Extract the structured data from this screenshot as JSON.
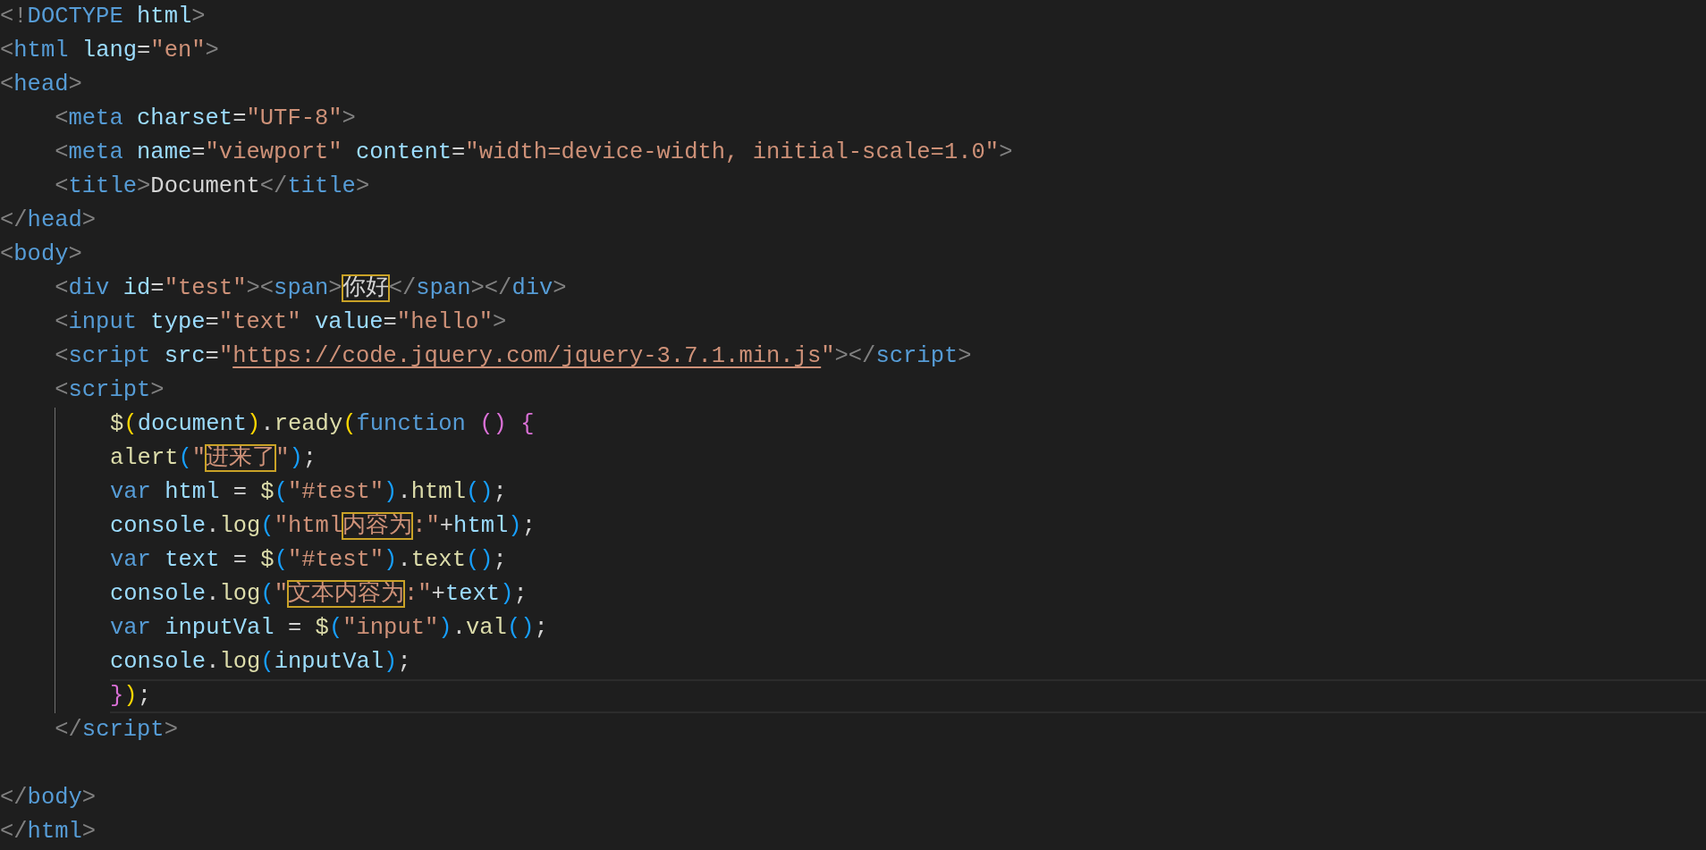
{
  "editor": {
    "lines": [
      {
        "kind": "line",
        "current": false,
        "tokens": [
          {
            "kind": "p",
            "text": "<!"
          },
          {
            "kind": "tag",
            "text": "DOCTYPE"
          },
          {
            "kind": "attr",
            "text": " html"
          },
          {
            "kind": "p",
            "text": ">"
          }
        ]
      },
      {
        "kind": "line",
        "current": false,
        "tokens": [
          {
            "kind": "p",
            "text": "<"
          },
          {
            "kind": "tag",
            "text": "html"
          },
          {
            "kind": "attr",
            "text": " lang"
          },
          {
            "kind": "txt",
            "text": "="
          },
          {
            "kind": "str",
            "text": "\"en\""
          },
          {
            "kind": "p",
            "text": ">"
          }
        ]
      },
      {
        "kind": "line",
        "current": false,
        "tokens": [
          {
            "kind": "p",
            "text": "<"
          },
          {
            "kind": "tag",
            "text": "head"
          },
          {
            "kind": "p",
            "text": ">"
          }
        ]
      },
      {
        "kind": "line",
        "current": false,
        "tokens": [
          {
            "kind": "p",
            "text": "    <"
          },
          {
            "kind": "tag",
            "text": "meta"
          },
          {
            "kind": "attr",
            "text": " charset"
          },
          {
            "kind": "txt",
            "text": "="
          },
          {
            "kind": "str",
            "text": "\"UTF-8\""
          },
          {
            "kind": "p",
            "text": ">"
          }
        ]
      },
      {
        "kind": "line",
        "current": false,
        "tokens": [
          {
            "kind": "p",
            "text": "    <"
          },
          {
            "kind": "tag",
            "text": "meta"
          },
          {
            "kind": "attr",
            "text": " name"
          },
          {
            "kind": "txt",
            "text": "="
          },
          {
            "kind": "str",
            "text": "\"viewport\""
          },
          {
            "kind": "attr",
            "text": " content"
          },
          {
            "kind": "txt",
            "text": "="
          },
          {
            "kind": "str",
            "text": "\"width=device-width, initial-scale=1.0\""
          },
          {
            "kind": "p",
            "text": ">"
          }
        ]
      },
      {
        "kind": "line",
        "current": false,
        "tokens": [
          {
            "kind": "p",
            "text": "    <"
          },
          {
            "kind": "tag",
            "text": "title"
          },
          {
            "kind": "p",
            "text": ">"
          },
          {
            "kind": "txt",
            "text": "Document"
          },
          {
            "kind": "p",
            "text": "</"
          },
          {
            "kind": "tag",
            "text": "title"
          },
          {
            "kind": "p",
            "text": ">"
          }
        ]
      },
      {
        "kind": "line",
        "current": false,
        "tokens": [
          {
            "kind": "p",
            "text": "</"
          },
          {
            "kind": "tag",
            "text": "head"
          },
          {
            "kind": "p",
            "text": ">"
          }
        ]
      },
      {
        "kind": "line",
        "current": false,
        "tokens": [
          {
            "kind": "p",
            "text": "<"
          },
          {
            "kind": "tag",
            "text": "body"
          },
          {
            "kind": "p",
            "text": ">"
          }
        ]
      },
      {
        "kind": "line",
        "current": false,
        "tokens": [
          {
            "kind": "p",
            "text": "    <"
          },
          {
            "kind": "tag",
            "text": "div"
          },
          {
            "kind": "attr",
            "text": " id"
          },
          {
            "kind": "txt",
            "text": "="
          },
          {
            "kind": "str",
            "text": "\"test\""
          },
          {
            "kind": "p",
            "text": "><"
          },
          {
            "kind": "tag",
            "text": "span"
          },
          {
            "kind": "p",
            "text": ">"
          },
          {
            "kind": "txtbox",
            "text": "你好"
          },
          {
            "kind": "p",
            "text": "</"
          },
          {
            "kind": "tag",
            "text": "span"
          },
          {
            "kind": "p",
            "text": "></"
          },
          {
            "kind": "tag",
            "text": "div"
          },
          {
            "kind": "p",
            "text": ">"
          }
        ]
      },
      {
        "kind": "line",
        "current": false,
        "tokens": [
          {
            "kind": "p",
            "text": "    <"
          },
          {
            "kind": "tag",
            "text": "input"
          },
          {
            "kind": "attr",
            "text": " type"
          },
          {
            "kind": "txt",
            "text": "="
          },
          {
            "kind": "str",
            "text": "\"text\""
          },
          {
            "kind": "attr",
            "text": " value"
          },
          {
            "kind": "txt",
            "text": "="
          },
          {
            "kind": "str",
            "text": "\"hello\""
          },
          {
            "kind": "p",
            "text": ">"
          }
        ]
      },
      {
        "kind": "line",
        "current": false,
        "tokens": [
          {
            "kind": "p",
            "text": "    <"
          },
          {
            "kind": "tag",
            "text": "script"
          },
          {
            "kind": "attr",
            "text": " src"
          },
          {
            "kind": "txt",
            "text": "="
          },
          {
            "kind": "str",
            "text": "\""
          },
          {
            "kind": "link",
            "text": "https://code.jquery.com/jquery-3.7.1.min.js"
          },
          {
            "kind": "str",
            "text": "\""
          },
          {
            "kind": "p",
            "text": "></"
          },
          {
            "kind": "tag",
            "text": "script"
          },
          {
            "kind": "p",
            "text": ">"
          }
        ]
      },
      {
        "kind": "line",
        "current": false,
        "tokens": [
          {
            "kind": "p",
            "text": "    <"
          },
          {
            "kind": "tag",
            "text": "script"
          },
          {
            "kind": "p",
            "text": ">"
          }
        ]
      },
      {
        "kind": "block",
        "lines": [
          {
            "current": false,
            "tokens": [
              {
                "kind": "fn",
                "text": "$"
              },
              {
                "kind": "b1",
                "text": "("
              },
              {
                "kind": "var",
                "text": "document"
              },
              {
                "kind": "b1",
                "text": ")"
              },
              {
                "kind": "txt",
                "text": "."
              },
              {
                "kind": "fn",
                "text": "ready"
              },
              {
                "kind": "b1",
                "text": "("
              },
              {
                "kind": "kw",
                "text": "function"
              },
              {
                "kind": "b2",
                "text": " ()"
              },
              {
                "kind": "b2",
                "text": " {"
              }
            ]
          },
          {
            "current": false,
            "tokens": [
              {
                "kind": "fn",
                "text": "alert"
              },
              {
                "kind": "b3",
                "text": "("
              },
              {
                "kind": "str",
                "text": "\""
              },
              {
                "kind": "strbox",
                "text": "进来了"
              },
              {
                "kind": "str",
                "text": "\""
              },
              {
                "kind": "b3",
                "text": ")"
              },
              {
                "kind": "txt",
                "text": ";"
              }
            ]
          },
          {
            "current": false,
            "tokens": [
              {
                "kind": "kw",
                "text": "var"
              },
              {
                "kind": "var",
                "text": " html"
              },
              {
                "kind": "txt",
                "text": " = "
              },
              {
                "kind": "fn",
                "text": "$"
              },
              {
                "kind": "b3",
                "text": "("
              },
              {
                "kind": "str",
                "text": "\"#test\""
              },
              {
                "kind": "b3",
                "text": ")"
              },
              {
                "kind": "txt",
                "text": "."
              },
              {
                "kind": "fn",
                "text": "html"
              },
              {
                "kind": "b3",
                "text": "()"
              },
              {
                "kind": "txt",
                "text": ";"
              }
            ]
          },
          {
            "current": false,
            "tokens": [
              {
                "kind": "var",
                "text": "console"
              },
              {
                "kind": "txt",
                "text": "."
              },
              {
                "kind": "fn",
                "text": "log"
              },
              {
                "kind": "b3",
                "text": "("
              },
              {
                "kind": "str",
                "text": "\"html"
              },
              {
                "kind": "strbox",
                "text": "内容为"
              },
              {
                "kind": "str",
                "text": ":\""
              },
              {
                "kind": "txt",
                "text": "+"
              },
              {
                "kind": "var",
                "text": "html"
              },
              {
                "kind": "b3",
                "text": ")"
              },
              {
                "kind": "txt",
                "text": ";"
              }
            ]
          },
          {
            "current": false,
            "tokens": [
              {
                "kind": "kw",
                "text": "var"
              },
              {
                "kind": "var",
                "text": " text"
              },
              {
                "kind": "txt",
                "text": " = "
              },
              {
                "kind": "fn",
                "text": "$"
              },
              {
                "kind": "b3",
                "text": "("
              },
              {
                "kind": "str",
                "text": "\"#test\""
              },
              {
                "kind": "b3",
                "text": ")"
              },
              {
                "kind": "txt",
                "text": "."
              },
              {
                "kind": "fn",
                "text": "text"
              },
              {
                "kind": "b3",
                "text": "()"
              },
              {
                "kind": "txt",
                "text": ";"
              }
            ]
          },
          {
            "current": false,
            "tokens": [
              {
                "kind": "var",
                "text": "console"
              },
              {
                "kind": "txt",
                "text": "."
              },
              {
                "kind": "fn",
                "text": "log"
              },
              {
                "kind": "b3",
                "text": "("
              },
              {
                "kind": "str",
                "text": "\""
              },
              {
                "kind": "strbox",
                "text": "文本内容为"
              },
              {
                "kind": "str",
                "text": ":\""
              },
              {
                "kind": "txt",
                "text": "+"
              },
              {
                "kind": "var",
                "text": "text"
              },
              {
                "kind": "b3",
                "text": ")"
              },
              {
                "kind": "txt",
                "text": ";"
              }
            ]
          },
          {
            "current": false,
            "tokens": [
              {
                "kind": "kw",
                "text": "var"
              },
              {
                "kind": "var",
                "text": " inputVal"
              },
              {
                "kind": "txt",
                "text": " = "
              },
              {
                "kind": "fn",
                "text": "$"
              },
              {
                "kind": "b3",
                "text": "("
              },
              {
                "kind": "str",
                "text": "\"input\""
              },
              {
                "kind": "b3",
                "text": ")"
              },
              {
                "kind": "txt",
                "text": "."
              },
              {
                "kind": "fn",
                "text": "val"
              },
              {
                "kind": "b3",
                "text": "()"
              },
              {
                "kind": "txt",
                "text": ";"
              }
            ]
          },
          {
            "current": false,
            "tokens": [
              {
                "kind": "var",
                "text": "console"
              },
              {
                "kind": "txt",
                "text": "."
              },
              {
                "kind": "fn",
                "text": "log"
              },
              {
                "kind": "b3",
                "text": "("
              },
              {
                "kind": "var",
                "text": "inputVal"
              },
              {
                "kind": "b3",
                "text": ")"
              },
              {
                "kind": "txt",
                "text": ";"
              }
            ]
          },
          {
            "current": true,
            "tokens": [
              {
                "kind": "b2",
                "text": "}"
              },
              {
                "kind": "b1",
                "text": ")"
              },
              {
                "kind": "txt",
                "text": ";"
              }
            ]
          }
        ]
      },
      {
        "kind": "line",
        "current": false,
        "tokens": [
          {
            "kind": "p",
            "text": "    </"
          },
          {
            "kind": "tag",
            "text": "script"
          },
          {
            "kind": "p",
            "text": ">"
          }
        ]
      },
      {
        "kind": "blank"
      },
      {
        "kind": "line",
        "current": false,
        "tokens": [
          {
            "kind": "p",
            "text": "</"
          },
          {
            "kind": "tag",
            "text": "body"
          },
          {
            "kind": "p",
            "text": ">"
          }
        ]
      },
      {
        "kind": "line",
        "current": false,
        "tokens": [
          {
            "kind": "p",
            "text": "</"
          },
          {
            "kind": "tag",
            "text": "html"
          },
          {
            "kind": "p",
            "text": ">"
          }
        ]
      }
    ]
  }
}
